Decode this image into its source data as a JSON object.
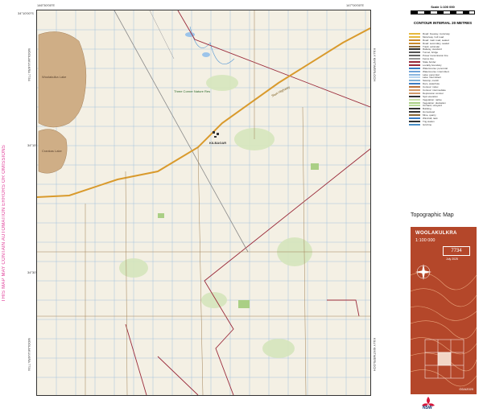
{
  "map": {
    "warning": "THIS MAP MAY CONTAIN AUTOMATION ERRORS OR OMISSIONS",
    "edge_left_top": "WOOLAKULKRA 7734",
    "edge_left_bottom": "WOOLAKULKRA 7734",
    "edge_right_top": "KILLY KINTWERLOCH",
    "edge_right_bottom": "KILLY KINTWERLOCH",
    "corner_tl_lat": "34°10'00\"S",
    "corner_tl_lon": "146°30'00\"E",
    "corner_tr_lon": "147°00'00\"E",
    "mid_lat": "34°15'",
    "lower_lat": "34°30'",
    "place_labels": {
      "lake_1": "Woolakulka Lake",
      "lake_2": "Crankas Lake",
      "nature_reserve": "Three Corner Nature Res",
      "town": "KILBAGAR",
      "highway": "Sturt Highway"
    }
  },
  "panel": {
    "scale_title": "Scale 1:100 000",
    "contour_note": "CONTOUR INTERVAL 20 METRES",
    "legend_items": [
      {
        "label": "Road: freeway, motorway",
        "color": "#e6b93d"
      },
      {
        "label": "Motorway / toll road",
        "color": "#e6b93d"
      },
      {
        "label": "Road: main road, sealed",
        "color": "#c9892c"
      },
      {
        "label": "Road: secondary, sealed",
        "color": "#c9892c"
      },
      {
        "label": "Track: vehicular",
        "color": "#8c6a3a"
      },
      {
        "label": "Railway, standard",
        "color": "#333333"
      },
      {
        "label": "Tunnel, bridge",
        "color": "#555555"
      },
      {
        "label": "Power transmission line",
        "color": "#666666"
      },
      {
        "label": "Fence line",
        "color": "#999999"
      },
      {
        "label": "State border",
        "color": "#9a2a3a"
      },
      {
        "label": "Locality boundary",
        "color": "#9a2a3a"
      },
      {
        "label": "Watercourse: perennial",
        "color": "#3b7dc4"
      },
      {
        "label": "Watercourse: intermittent",
        "color": "#6fa3d8"
      },
      {
        "label": "Lake: perennial",
        "color": "#8ab6e0"
      },
      {
        "label": "Lake: intermittent",
        "color": "#b9d5ee"
      },
      {
        "label": "Swamp, marsh",
        "color": "#7fb0d4"
      },
      {
        "label": "Dam, waterhole",
        "color": "#3b7dc4"
      },
      {
        "label": "Contour: index",
        "color": "#b8733a"
      },
      {
        "label": "Contour: intermediate",
        "color": "#d29b6a"
      },
      {
        "label": "Depression contour",
        "color": "#d29b6a"
      },
      {
        "label": "Spot elevation",
        "color": "#333333"
      },
      {
        "label": "Vegetation: native",
        "color": "#c7dea8"
      },
      {
        "label": "Vegetation: plantation",
        "color": "#a9cf84"
      },
      {
        "label": "Orchard, vineyard",
        "color": "#b8d998"
      },
      {
        "label": "Building",
        "color": "#333333"
      },
      {
        "label": "Homestead",
        "color": "#333333"
      },
      {
        "label": "Mine, quarry",
        "color": "#8c6a3a"
      },
      {
        "label": "Windmill, tank",
        "color": "#3b7dc4"
      },
      {
        "label": "Trig station",
        "color": "#333333"
      },
      {
        "label": "Grid line",
        "color": "#4a8fc8"
      }
    ],
    "topo_title": "Topographic Map",
    "map_name": "WOOLAKULKRA",
    "map_scale": "1:100 000",
    "sheet_number": "7734",
    "date": "July 2025",
    "datum": "GDA2020",
    "logo_text": "NSW"
  }
}
